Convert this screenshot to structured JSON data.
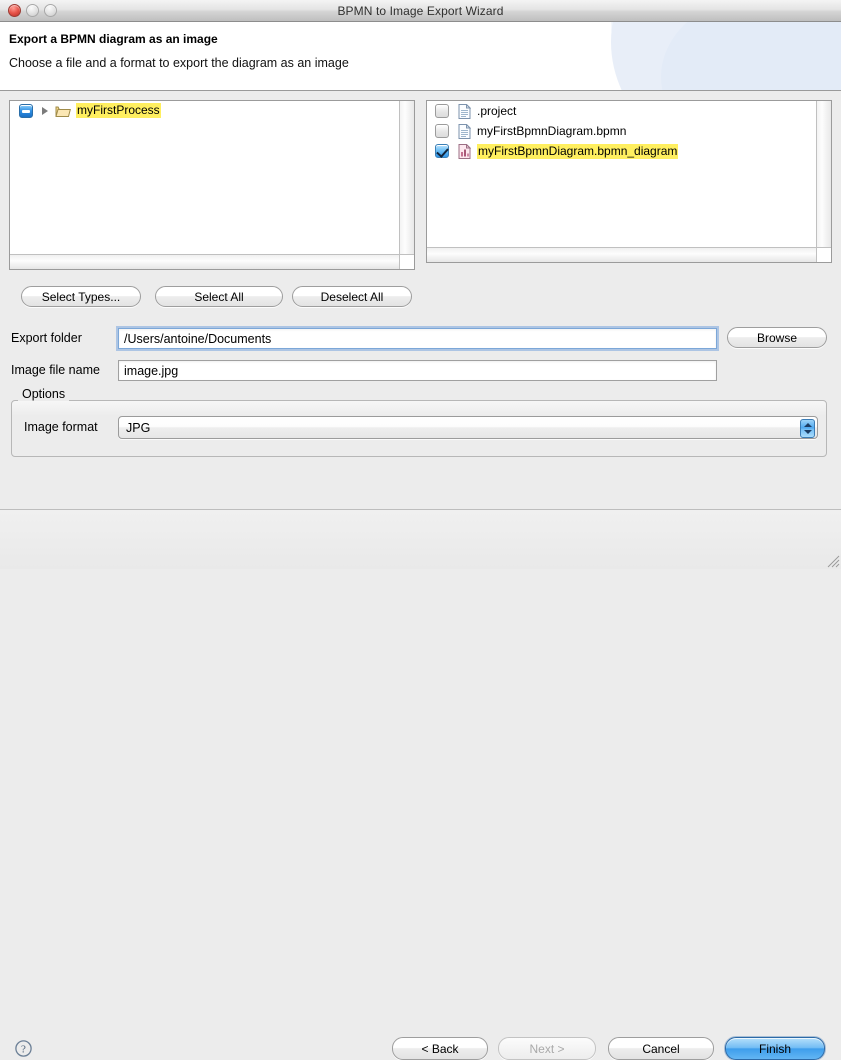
{
  "window": {
    "title": "BPMN to Image Export Wizard",
    "controls": {
      "close": "close-button",
      "minimize": "minimize-button",
      "maximize": "maximize-button"
    }
  },
  "banner": {
    "title": "Export a BPMN diagram as an image",
    "subtitle": "Choose a file and a format to export the diagram as an image"
  },
  "tree": {
    "items": [
      {
        "label": "myFirstProcess",
        "checkbox": "mixed",
        "expanded": false,
        "icon": "folder-icon",
        "highlighted": true
      }
    ]
  },
  "files": {
    "items": [
      {
        "label": ".project",
        "checkbox": "off",
        "icon": "file-icon",
        "highlighted": false
      },
      {
        "label": "myFirstBpmnDiagram.bpmn",
        "checkbox": "off",
        "icon": "file-icon",
        "highlighted": false
      },
      {
        "label": "myFirstBpmnDiagram.bpmn_diagram",
        "checkbox": "on",
        "icon": "diagram-icon",
        "highlighted": true
      }
    ]
  },
  "selection_buttons": {
    "select_types": "Select Types...",
    "select_all": "Select All",
    "deselect_all": "Deselect All"
  },
  "fields": {
    "export_folder_label": "Export folder",
    "export_folder_value": "/Users/antoine/Documents",
    "browse": "Browse",
    "image_file_label": "Image file name",
    "image_file_value": "image.jpg"
  },
  "options": {
    "group_label": "Options",
    "image_format_label": "Image format",
    "image_format_value": "JPG"
  },
  "footer": {
    "help": "help-icon",
    "back": "< Back",
    "next": "Next >",
    "cancel": "Cancel",
    "finish": "Finish"
  },
  "colors": {
    "highlight": "#ffef5f",
    "accent": "#3e9eec",
    "checkbox_on": "#2f93e6",
    "window_bg": "#ececec"
  }
}
